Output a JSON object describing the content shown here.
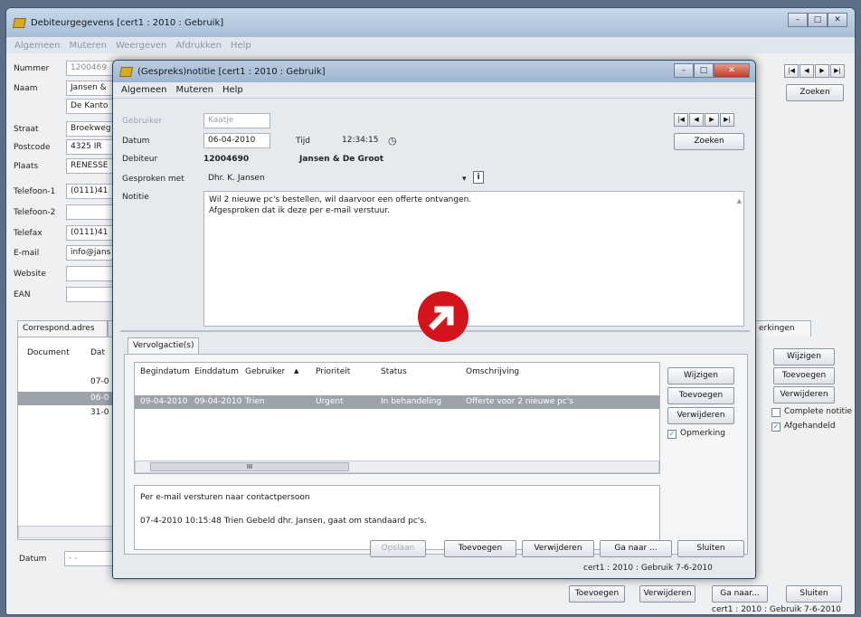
{
  "main_window": {
    "title": "Debiteurgegevens [cert1 : 2010 : Gebruik]",
    "menu": [
      "Algemeen",
      "Muteren",
      "Weergeven",
      "Afdrukken",
      "Help"
    ],
    "control_icons": [
      "minimize-icon",
      "maximize-icon",
      "close-icon"
    ],
    "fields": [
      {
        "label": "Nummer",
        "value": "1200469"
      },
      {
        "label": "Naam",
        "value": "Jansen &"
      },
      {
        "label": "",
        "value": "De Kanto"
      },
      {
        "label": "Straat",
        "value": "Broekweg"
      },
      {
        "label": "Postcode",
        "value": "4325 IR"
      },
      {
        "label": "Plaats",
        "value": "RENESSE"
      },
      {
        "label": "Telefoon-1",
        "value": "(0111)41"
      },
      {
        "label": "Telefoon-2",
        "value": ""
      },
      {
        "label": "Telefax",
        "value": "(0111)41"
      },
      {
        "label": "E-mail",
        "value": "info@jans"
      },
      {
        "label": "Website",
        "value": ""
      },
      {
        "label": "EAN",
        "value": ""
      }
    ],
    "nav_glyphs": [
      "|◀",
      "◀",
      "▶",
      "▶|"
    ],
    "zoeken": "Zoeken",
    "tabs_left": [
      "Correspond.adres",
      ""
    ],
    "tab_right": "erkingen",
    "grid_headers": [
      "Document",
      "Dat"
    ],
    "grid_rows": [
      "07-0",
      "06-0",
      "31-0"
    ],
    "side_buttons": [
      "Wijzigen",
      "Toevoegen",
      "Verwijderen"
    ],
    "checkboxes": [
      {
        "label": "Complete notitie",
        "checked": false
      },
      {
        "label": "Afgehandeld",
        "checked": true
      }
    ],
    "datum_label": "Datum",
    "datum_value": "- -",
    "bottom_buttons": [
      "Toevoegen",
      "Verwijderen",
      "Ga naar...",
      "Sluiten"
    ],
    "status": "cert1 : 2010 : Gebruik  7-6-2010"
  },
  "dialog": {
    "title": "(Gespreks)notitie [cert1 : 2010 : Gebruik]",
    "menu": [
      "Algemeen",
      "Muteren",
      "Help"
    ],
    "gebruiker_label": "Gebruiker",
    "gebruiker_value": "Kaatje",
    "datum_label": "Datum",
    "datum_value": "06-04-2010",
    "tijd_label": "Tijd",
    "tijd_value": "12:34:15",
    "debiteur_label": "Debiteur",
    "debiteur_number": "12004690",
    "debiteur_name": "Jansen & De Groot",
    "gesproken_label": "Gesproken met",
    "gesproken_value": "Dhr. K. Jansen",
    "notitie_label": "Notitie",
    "notitie_lines": [
      "Wil 2 nieuwe pc's bestellen, wil daarvoor een offerte ontvangen.",
      "Afgesproken dat ik deze per e-mail verstuur."
    ],
    "nav_glyphs": [
      "|◀",
      "◀",
      "▶",
      "▶|"
    ],
    "zoeken": "Zoeken",
    "sub_tab": "Vervolgactie(s)",
    "table_headers": [
      "Begindatum",
      "Einddatum",
      "Gebruiker",
      "Prioriteit",
      "Status",
      "Omschrijving"
    ],
    "table_rows": [
      [
        "09-04-2010",
        "09-04-2010",
        "Trien",
        "Urgent",
        "In behandeling",
        "Offerte voor 2 nieuwe pc's"
      ]
    ],
    "scroll_mark": "III",
    "action_buttons": [
      "Wijzigen",
      "Toevoegen",
      "Verwijderen"
    ],
    "opmerking_label": "Opmerking",
    "opmerking_checked": true,
    "memo_lines": [
      "Per e-mail versturen naar contactpersoon",
      "07-4-2010 10:15:48 Trien Gebeld dhr. Jansen, gaat om standaard pc's."
    ],
    "bottom_buttons": [
      "Opslaan",
      "Toevoegen",
      "Verwijderen",
      "Ga naar ...",
      "Sluiten"
    ],
    "status": "cert1 : 2010 : Gebruik  7-6-2010"
  },
  "colors": {
    "desktop": "#5c6f86",
    "titlebar": "#b7c9de",
    "selection": "#9da3ab",
    "badge_red": "#d3141c",
    "window_bg": "#eef0f2"
  },
  "icons": [
    "app-icon",
    "clock-icon",
    "info-icon",
    "dropdown-arrow-icon",
    "sort-ascending-icon",
    "arrow-badge-icon"
  ]
}
